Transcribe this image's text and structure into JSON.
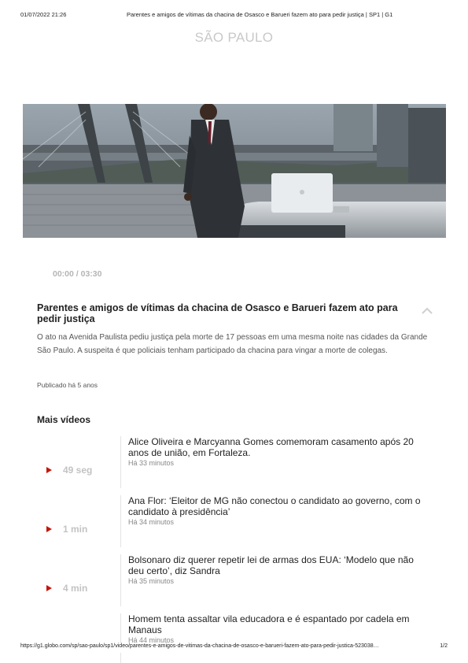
{
  "print_header": {
    "datetime": "01/07/2022 21:26",
    "page_title": "Parentes e amigos de vítimas da chacina de Osasco e Barueri fazem ato para pedir justiça | SP1 | G1"
  },
  "section": "SÃO PAULO",
  "player": {
    "time": "00:00 / 03:30"
  },
  "article": {
    "title": "Parentes e amigos de vítimas da chacina de Osasco e Barueri fazem ato para pedir justiça",
    "description": "O ato na Avenida Paulista pediu justiça pela morte de 17 pessoas em uma mesma noite nas cidades da Grande São Paulo. A suspeita é que policiais tenham participado da chacina para vingar a morte de colegas.",
    "published": "Publicado há 5 anos"
  },
  "more_videos": {
    "heading": "Mais vídeos",
    "items": [
      {
        "duration": "49 seg",
        "title": "Alice Oliveira e Marcyanna Gomes comemoram casamento após 20 anos de união, em Fortaleza.",
        "time": "Há 33 minutos"
      },
      {
        "duration": "1 min",
        "title": "Ana Flor: ‘Eleitor de MG não conectou o candidato ao governo, com o candidato à presidência’",
        "time": "Há 34 minutos"
      },
      {
        "duration": "4 min",
        "title": "Bolsonaro diz querer repetir lei de armas dos EUA: ‘Modelo que não deu certo’, diz Sandra",
        "time": "Há 35 minutos"
      },
      {
        "duration": "",
        "title": "Homem tenta assaltar vila educadora e é espantado por cadela em Manaus",
        "time": "Há 44 minutos"
      }
    ]
  },
  "print_footer": {
    "url": "https://g1.globo.com/sp/sao-paulo/sp1/video/parentes-e-amigos-de-vitimas-da-chacina-de-osasco-e-barueri-fazem-ato-para-pedir-justica-523038…",
    "page": "1/2"
  },
  "colors": {
    "accent_red": "#c4170c",
    "muted_gray": "#c3c3c3"
  },
  "icons": {
    "play": "play-icon",
    "collapse": "chevron-up-icon"
  }
}
